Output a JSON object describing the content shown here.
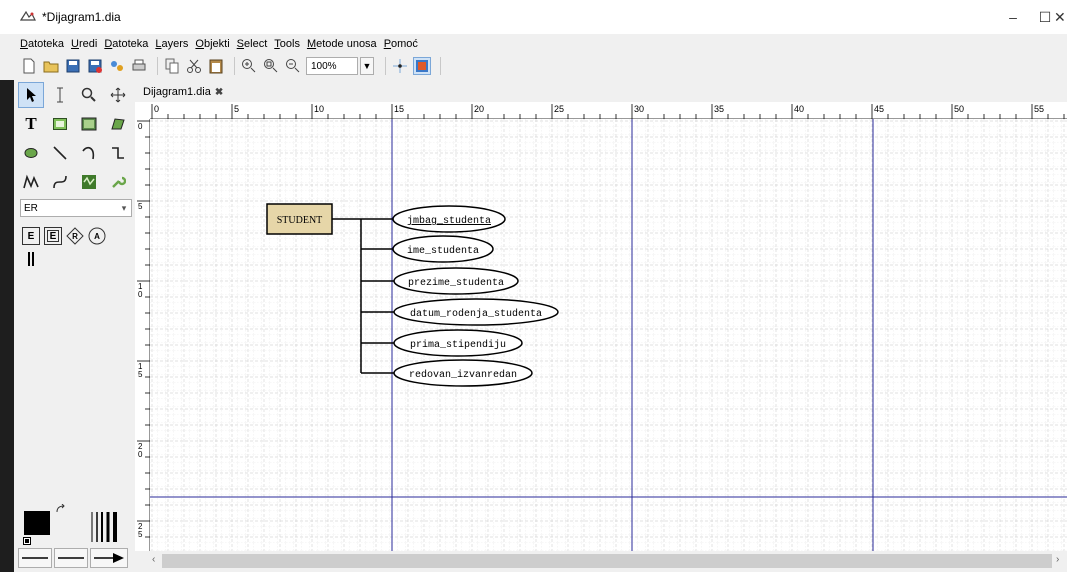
{
  "window": {
    "title": "*Dijagram1.dia",
    "minimize": "–",
    "maximize": "☐",
    "close": "✕"
  },
  "menu": [
    "Datoteka",
    "Uredi",
    "Datoteka",
    "Layers",
    "Objekti",
    "Select",
    "Tools",
    "Metode unosa",
    "Pomoć"
  ],
  "toolbar": {
    "zoom_value": "100%"
  },
  "toolbox": {
    "sheet_value": "ER",
    "er_tools": [
      "E",
      "E",
      "R",
      "A"
    ]
  },
  "tab": {
    "label": "Dijagram1.dia",
    "close": "✖"
  },
  "rulers": {
    "h_ticks": [
      "0",
      "5",
      "10",
      "15",
      "20",
      "25",
      "30",
      "35",
      "40",
      "45",
      "50",
      "55"
    ],
    "v_ticks": [
      "0",
      "5",
      "10",
      "15",
      "20",
      "25"
    ]
  },
  "diagram": {
    "entity": "STUDENT",
    "attributes": [
      "jmbag_studenta",
      "ime_studenta",
      "prezime_studenta",
      "datum_rodenja_studenta",
      "prima_stipendiju",
      "redovan_izvanredan"
    ],
    "key_attribute": "jmbag_studenta"
  },
  "colors": {
    "entity_fill": "#e6d6a8",
    "grid": "#d4d4d4",
    "guide": "#2a2a9a",
    "accent": "#0078d7"
  }
}
